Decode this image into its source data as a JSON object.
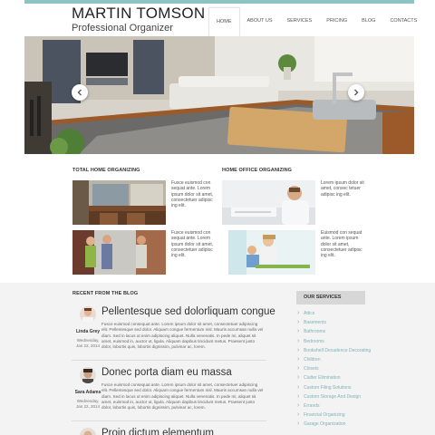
{
  "brand": {
    "name": "MARTIN TOMSON",
    "tagline": "Professional Organizer"
  },
  "nav": [
    {
      "label": "HOME",
      "active": true
    },
    {
      "label": "ABOUT US"
    },
    {
      "label": "SERVICES"
    },
    {
      "label": "PRICING"
    },
    {
      "label": "BLOG"
    },
    {
      "label": "CONTACTS"
    }
  ],
  "sections": {
    "home": {
      "title": "TOTAL HOME ORGANIZING"
    },
    "office": {
      "title": "HOME OFFICE ORGANIZING"
    }
  },
  "blurbs": {
    "b1": "Fusce euismod con sequat ante. Lorem ipsum dolor sit amet, consectetuer adipisc ing elit.",
    "b2": "Lorem ipsum dolor sit amet, consec tetuer adipisc ing elit.",
    "b3": "Fusce euismod con sequat ante. Lorem ipsum dolor sit amet, consectetuer adipisc ing elit.",
    "b4": "Euismod con sequat ante. Lorem ipsum dolor sit amet, consectetuer adipisc ing elit."
  },
  "blog": {
    "title": "RECENT FROM THE BLOG",
    "posts": [
      {
        "title": "Pellentesque sed dolorliquam congue",
        "author": "Linda Grey",
        "weekday": "Wednesday,",
        "date": "Jan 22, 2014",
        "body": "Fusce euismod consequat ante. Lorem ipsum dolor sit amet, consectetuer adipiscing elit. Pellentesque sed dolor. Aliquam congue fermentum nisl. Mauris accumsan nulla vel diam. Sed in lacus ut enim adipiscing aliquet. Nulla venenatis. In pede mi, aliquet sit amet, euismod in, auctor ut, ligula. Aliquam dapibus tincidunt metus. Praesent justo dolor, lobortis quis, lobortis dignissim, pulvinar ac, lorem."
      },
      {
        "title": "Donec porta diam eu massa",
        "author": "Sara Adams",
        "weekday": "Wednesday,",
        "date": "Jan 22, 2014",
        "body": "Fusce euismod consequat ante. Lorem ipsum dolor sit amet, consectetuer adipiscing elit. Pellentesque sed dolor. Aliquam congue fermentum nisl. Mauris accumsan nulla vel diam. Sed in lacus ut enim adipiscing aliquet. Nulla venenatis. In pede mi, aliquet sit amet, euismod in, auctor ut, ligula. Aliquam dapibus tincidunt metus. Praesent justo dolor, lobortis quis, lobortis dignissim, pulvinar ac, lorem."
      },
      {
        "title": "Proin dictum elementum"
      }
    ]
  },
  "services": {
    "title": "OUR SERVICES",
    "items": [
      "Attics",
      "Basements",
      "Bathrooms",
      "Bedrooms",
      "Bookshelf Decadence Decorating",
      "Children",
      "Closets",
      "Clutter Elimination",
      "Custom Filing Solutions",
      "Custom Storage And Design",
      "Errands",
      "Financial Organizing",
      "Garage Organization"
    ]
  },
  "colors": {
    "accent": "#8ec3c4",
    "link": "#7fb3b5"
  },
  "icons": {
    "prev": "chevron-left-icon",
    "next": "chevron-right-icon"
  }
}
